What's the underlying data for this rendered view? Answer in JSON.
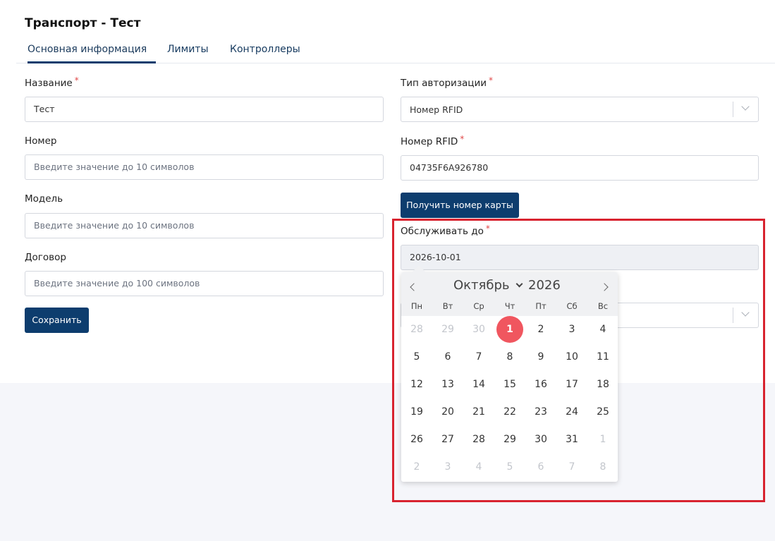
{
  "page": {
    "title": "Транспорт - Тест"
  },
  "tabs": [
    {
      "label": "Основная информация"
    },
    {
      "label": "Лимиты"
    },
    {
      "label": "Контроллеры"
    }
  ],
  "form": {
    "name": {
      "label": "Название",
      "value": "Тест"
    },
    "number": {
      "label": "Номер",
      "placeholder": "Введите значение до 10 символов"
    },
    "model": {
      "label": "Модель",
      "placeholder": "Введите значение до 10 символов"
    },
    "contract": {
      "label": "Договор",
      "placeholder": "Введите значение до 100 символов"
    },
    "save_label": "Сохранить",
    "auth_type": {
      "label": "Тип авторизации",
      "value": "Номер RFID"
    },
    "rfid": {
      "label": "Номер RFID",
      "value": "04735F6A926780"
    },
    "get_card_label": "Получить номер карты",
    "serve_until": {
      "label": "Обслуживать до",
      "value": "2026-10-01"
    },
    "required_mark": "*"
  },
  "datepicker": {
    "month": "Октябрь",
    "year": "2026",
    "weekdays": [
      "Пн",
      "Вт",
      "Ср",
      "Чт",
      "Пт",
      "Сб",
      "Вс"
    ],
    "weeks": [
      [
        "28",
        "29",
        "30",
        "1",
        "2",
        "3",
        "4"
      ],
      [
        "5",
        "6",
        "7",
        "8",
        "9",
        "10",
        "11"
      ],
      [
        "12",
        "13",
        "14",
        "15",
        "16",
        "17",
        "18"
      ],
      [
        "19",
        "20",
        "21",
        "22",
        "23",
        "24",
        "25"
      ],
      [
        "26",
        "27",
        "28",
        "29",
        "30",
        "31",
        "1"
      ],
      [
        "2",
        "3",
        "4",
        "5",
        "6",
        "7",
        "8"
      ]
    ],
    "selected_day": "1",
    "muted_cells": [
      [
        0,
        0
      ],
      [
        0,
        1
      ],
      [
        0,
        2
      ],
      [
        4,
        6
      ],
      [
        5,
        0
      ],
      [
        5,
        1
      ],
      [
        5,
        2
      ],
      [
        5,
        3
      ],
      [
        5,
        4
      ],
      [
        5,
        5
      ],
      [
        5,
        6
      ]
    ]
  },
  "colors": {
    "primary": "#0d3d6e",
    "selected": "#f0565f",
    "highlight": "#d8232f",
    "required": "#e04848"
  }
}
